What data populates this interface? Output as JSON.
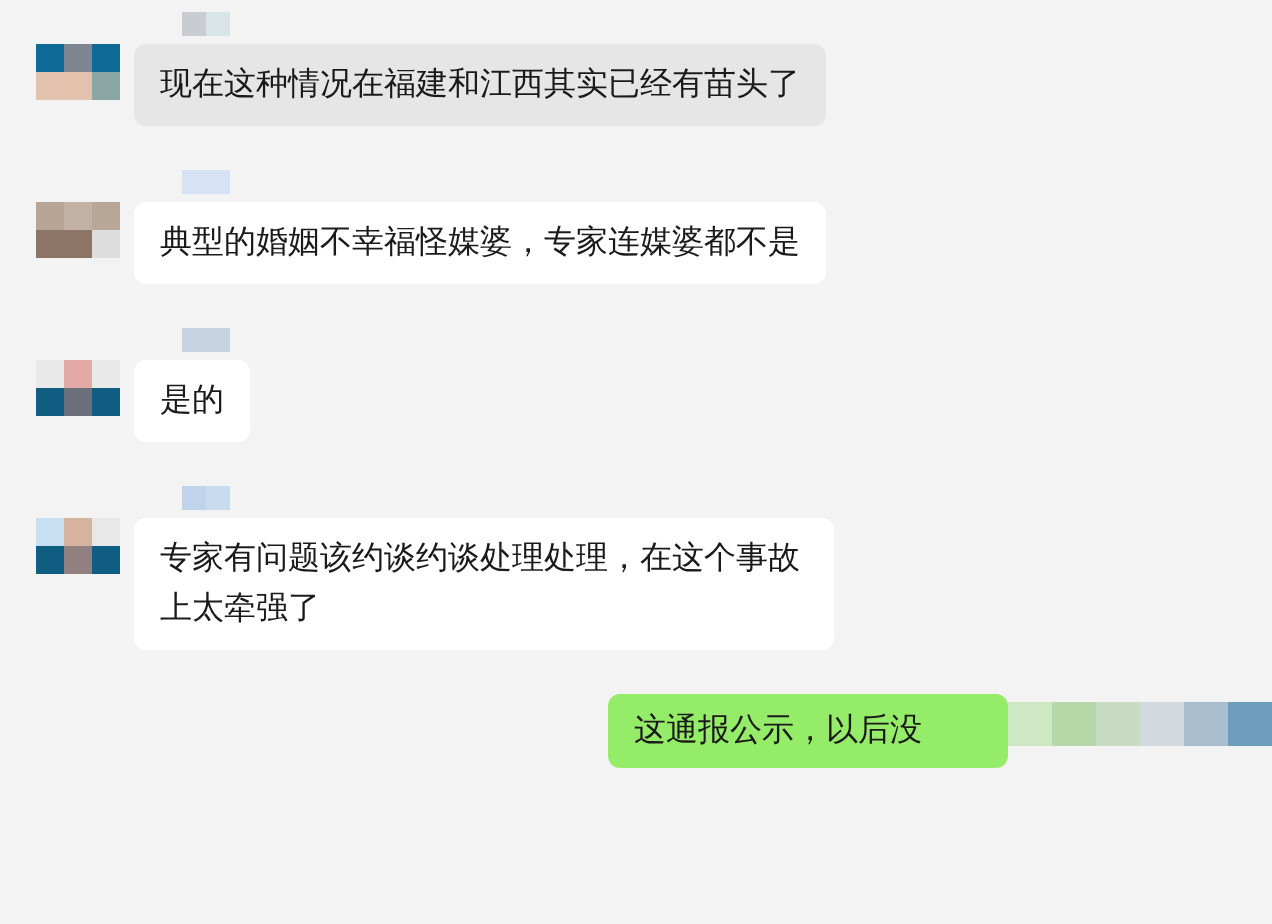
{
  "messages": [
    {
      "kind": "incoming",
      "text": "现在这种情况在福建和江西其实已经有苗头了",
      "highlighted": true
    },
    {
      "kind": "incoming",
      "text": "典型的婚姻不幸福怪媒婆，专家连媒婆都不是",
      "highlighted": false
    },
    {
      "kind": "incoming",
      "text": "是的",
      "highlighted": false
    },
    {
      "kind": "incoming",
      "text": "专家有问题该约谈约谈处理处理，在这个事故上太牵强了",
      "highlighted": false
    },
    {
      "kind": "outgoing",
      "text": "这通报公示，以后没",
      "highlighted": false
    }
  ]
}
